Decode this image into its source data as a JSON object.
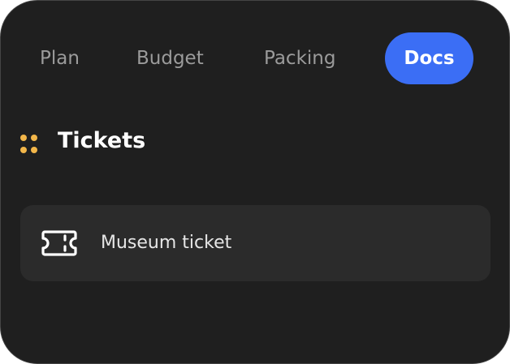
{
  "tabs": [
    {
      "label": "Plan",
      "active": false
    },
    {
      "label": "Budget",
      "active": false
    },
    {
      "label": "Packing",
      "active": false
    },
    {
      "label": "Docs",
      "active": true
    }
  ],
  "section": {
    "title": "Tickets",
    "icon": "drag-handle-icon",
    "icon_color": "#f2b64a"
  },
  "items": [
    {
      "label": "Museum ticket",
      "icon": "ticket-icon"
    }
  ],
  "colors": {
    "background": "#1f1f1f",
    "accent": "#3b6ef5",
    "item_background": "#2b2b2b",
    "inactive_tab_text": "#9b9b9b"
  }
}
